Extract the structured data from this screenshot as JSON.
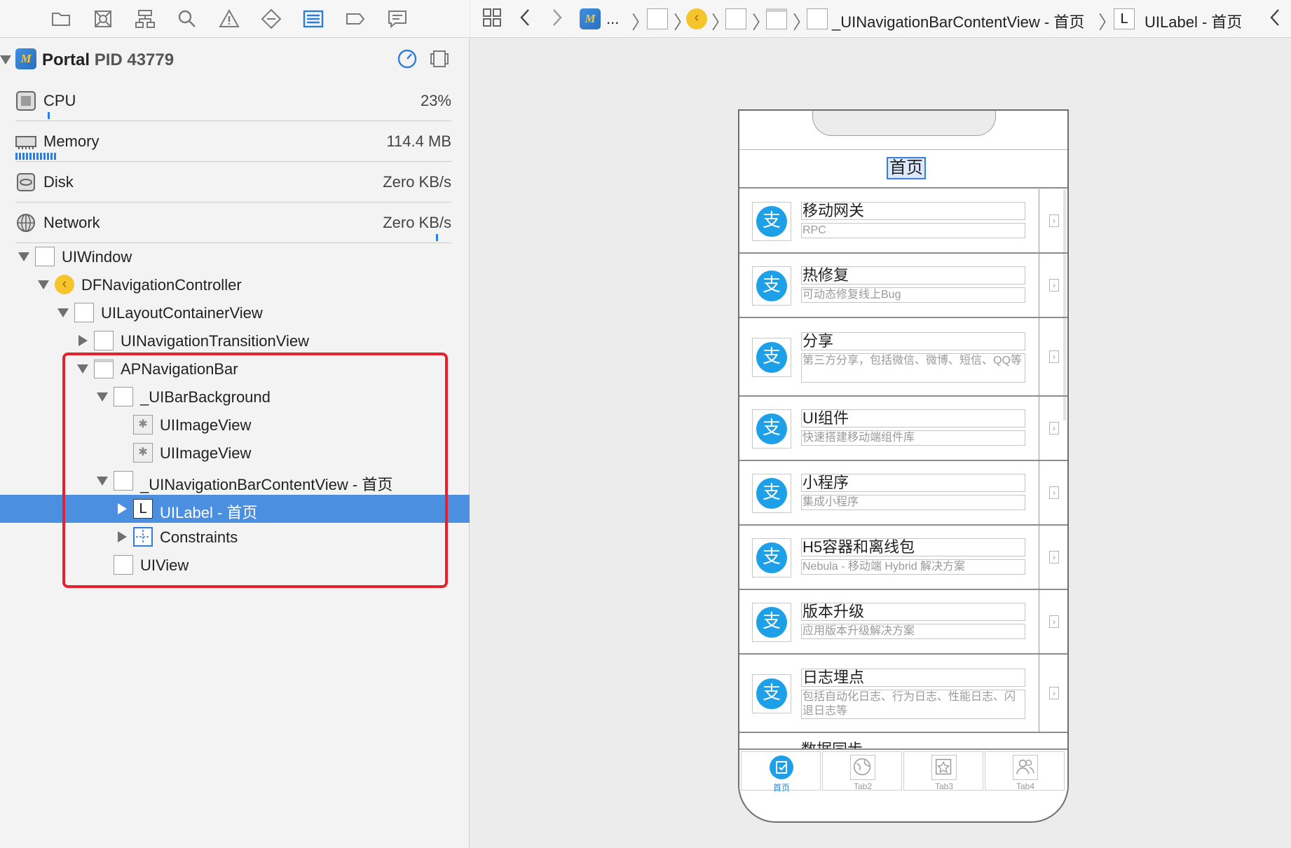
{
  "process": {
    "name": "Portal",
    "pid": "PID 43779"
  },
  "gauges": {
    "cpu": {
      "label": "CPU",
      "value": "23%"
    },
    "memory": {
      "label": "Memory",
      "value": "114.4 MB"
    },
    "disk": {
      "label": "Disk",
      "value": "Zero KB/s"
    },
    "network": {
      "label": "Network",
      "value": "Zero KB/s"
    }
  },
  "tree": [
    {
      "label": "UIWindow"
    },
    {
      "label": "DFNavigationController"
    },
    {
      "label": "UILayoutContainerView"
    },
    {
      "label": "UINavigationTransitionView"
    },
    {
      "label": "APNavigationBar"
    },
    {
      "label": "_UIBarBackground"
    },
    {
      "label": "UIImageView"
    },
    {
      "label": "UIImageView"
    },
    {
      "label": "_UINavigationBarContentView - 首页"
    },
    {
      "label": "UILabel - 首页",
      "selected": true
    },
    {
      "label": "Constraints"
    },
    {
      "label": "UIView"
    }
  ],
  "jumpbar": {
    "ellipsis": "...",
    "content_view": "_UINavigationBarContentView - 首页",
    "label_letter": "L",
    "label_item": "UILabel - 首页"
  },
  "phone": {
    "nav_title": "首页",
    "cells": [
      {
        "title": "移动网关",
        "subtitle": "RPC"
      },
      {
        "title": "热修复",
        "subtitle": "可动态修复线上Bug"
      },
      {
        "title": "分享",
        "subtitle": "第三方分享，包括微信、微博、短信、QQ等"
      },
      {
        "title": "UI组件",
        "subtitle": "快速搭建移动端组件库"
      },
      {
        "title": "小程序",
        "subtitle": "集成小程序"
      },
      {
        "title": "H5容器和离线包",
        "subtitle": "Nebula - 移动端 Hybrid 解决方案"
      },
      {
        "title": "版本升级",
        "subtitle": "应用版本升级解决方案"
      },
      {
        "title": "日志埋点",
        "subtitle": "包括自动化日志、行为日志、性能日志、闪退日志等"
      }
    ],
    "peek_title": "数据同步",
    "icon_glyph": "支",
    "tabs": [
      {
        "label": "首页"
      },
      {
        "label": "Tab2"
      },
      {
        "label": "Tab3"
      },
      {
        "label": "Tab4"
      }
    ]
  },
  "colors": {
    "selection": "#4a8fe0",
    "highlight": "#e8202e",
    "alipay_blue": "#1ea0e8"
  }
}
